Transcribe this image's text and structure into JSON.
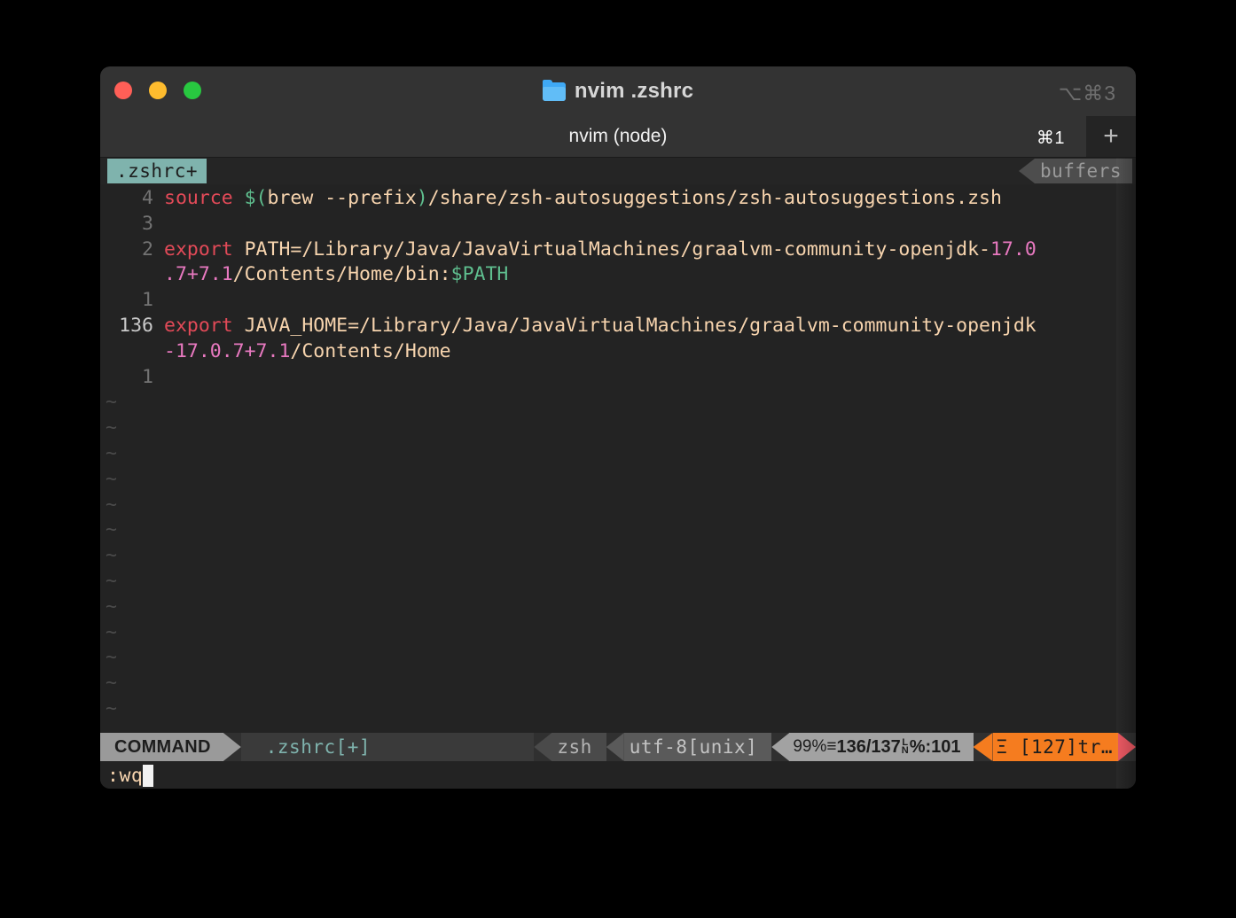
{
  "window": {
    "title": "nvim .zshrc",
    "title_icon": "folder-icon",
    "title_shortcut": "⌥⌘3",
    "traffic_lights": {
      "close_color": "#FF5F57",
      "minimize_color": "#FEBC2E",
      "maximize_color": "#28C840"
    }
  },
  "tabbar": {
    "active_tab_label": "nvim (node)",
    "tab_shortcut": "⌘1",
    "new_tab_label": "+"
  },
  "bufferline": {
    "buffer_label": ".zshrc+",
    "right_label": "buffers",
    "buffer_bg": "#7fb3ad"
  },
  "editor": {
    "lines": [
      {
        "number": "4",
        "current": false,
        "segments": [
          {
            "text": "source ",
            "color": "#e34a58"
          },
          {
            "text": "$(",
            "color": "#5fbf8f"
          },
          {
            "text": "brew --prefix",
            "color": "#f7d4ae"
          },
          {
            "text": ")",
            "color": "#5fbf8f"
          },
          {
            "text": "/share/zsh-autosuggestions/zsh-autosuggestions.zsh",
            "color": "#f7d4ae"
          }
        ]
      },
      {
        "number": "3",
        "current": false,
        "segments": []
      },
      {
        "number": "2",
        "current": false,
        "segments": [
          {
            "text": "export ",
            "color": "#e34a58"
          },
          {
            "text": "PATH=/Library/Java/JavaVirtualMachines/graalvm-community-openjdk-",
            "color": "#f7d4ae"
          },
          {
            "text": "17.0",
            "color": "#e879c0"
          }
        ]
      },
      {
        "number": "",
        "wrap": true,
        "segments": [
          {
            "text": ".7+7.1",
            "color": "#e879c0"
          },
          {
            "text": "/Contents/Home/bin:",
            "color": "#f7d4ae"
          },
          {
            "text": "$PATH",
            "color": "#5fbf8f"
          }
        ]
      },
      {
        "number": "1",
        "current": false,
        "segments": []
      },
      {
        "number": "136",
        "current": true,
        "segments": [
          {
            "text": "export ",
            "color": "#e34a58"
          },
          {
            "text": "JAVA_HOME=/Library/Java/JavaVirtualMachines/graalvm-community-openjdk",
            "color": "#f7d4ae"
          }
        ]
      },
      {
        "number": "",
        "wrap": true,
        "segments": [
          {
            "text": "-17.0.7+7.1",
            "color": "#e879c0"
          },
          {
            "text": "/Contents/Home",
            "color": "#f7d4ae"
          }
        ]
      },
      {
        "number": "1",
        "current": false,
        "segments": []
      }
    ],
    "empty_marker": "~",
    "empty_marker_count": 14
  },
  "statusline": {
    "mode": "COMMAND",
    "filename": ".zshrc[+]",
    "filetype": "zsh",
    "encoding": "utf-8[unix]",
    "percent": "99%",
    "lines_glyph": "≡",
    "position": "136/137",
    "col_sup": "L",
    "col_sub": "N",
    "col_label": "%:",
    "column": "101",
    "git_glyph": "Ξ",
    "git_text": "[127]tr…",
    "git_bg": "#f57c1f",
    "end_color": "#e8555f"
  },
  "cmdline": {
    "text": ":wq",
    "cursor": "block"
  }
}
